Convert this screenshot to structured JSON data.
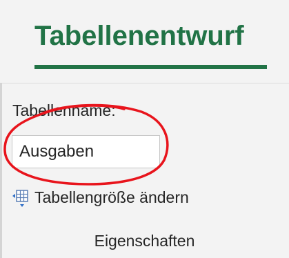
{
  "tab": {
    "title": "Tabellenentwurf",
    "accent_color": "#217346"
  },
  "properties_group": {
    "table_name_label": "Tabellenname:",
    "table_name_value": "Ausgaben",
    "resize_button_label": "Tabellengröße ändern",
    "resize_icon": "table-resize-icon",
    "group_label": "Eigenschaften"
  },
  "annotation": {
    "color": "#e8141c",
    "shape": "hand-drawn-circle"
  }
}
